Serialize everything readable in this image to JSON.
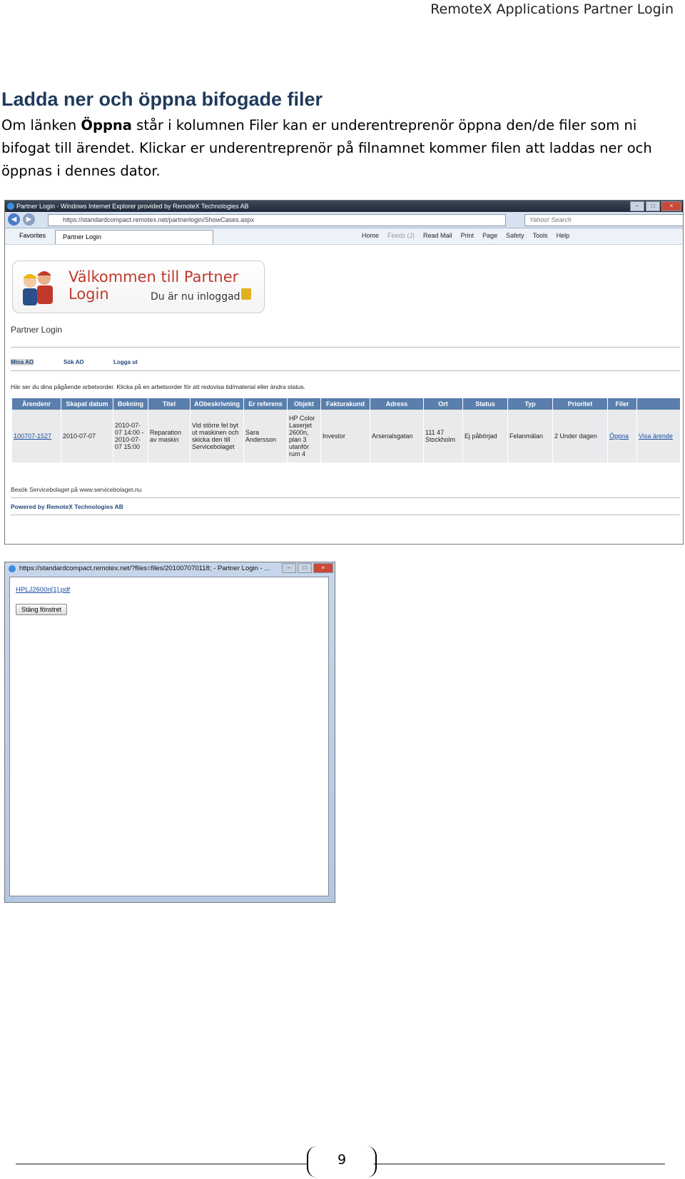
{
  "doc_header": "RemoteX Applications Partner Login",
  "heading": "Ladda ner och öppna bifogade filer",
  "paragraph": {
    "before_bold": "Om länken ",
    "bold": "Öppna",
    "after_bold": " står i kolumnen Filer kan er underentreprenör öppna den/de filer som ni bifogat till ärendet. Klickar er underentreprenör på filnamnet kommer filen att laddas ner och öppnas i dennes dator."
  },
  "browser": {
    "title": "Partner Login - Windows Internet Explorer provided by RemoteX Technologies AB",
    "url": "https://standardcompact.remotex.net/partnerlogin/ShowCases.aspx",
    "search_placeholder": "Yahoo! Search",
    "favorites": "Favorites",
    "tab": "Partner Login",
    "toolbar": [
      "Home",
      "Feeds (J)",
      "Read Mail",
      "Print",
      "Page",
      "Safety",
      "Tools",
      "Help"
    ],
    "welcome": "Välkommen till Partner Login",
    "logged_in": "Du är nu inloggad",
    "section_title": "Partner Login",
    "menu": [
      "Mina AO",
      "Sök AO",
      "Logga ut"
    ],
    "info": "Här ser du dina pågående arbetsorder. Klicka på en arbetsorder för att redovisa tid/material eller ändra status.",
    "columns": [
      "Ärendenr",
      "Skapat datum",
      "Bokning",
      "Titel",
      "AObeskrivning",
      "Er referens",
      "Objekt",
      "Fakturakund",
      "Adress",
      "Ort",
      "Status",
      "Typ",
      "Prioritet",
      "Filer",
      ""
    ],
    "row": {
      "case_no": "100707-1527",
      "created": "2010-07-07",
      "booking": "2010-07-07 14:00 - 2010-07-07 15:00",
      "title": "Reparation av maskin",
      "description": "Vid större fel byt ut maskinen och skicka den till Servicebolaget",
      "reference": "Sara Andersson",
      "object": "HP Color Laserjet 2600n, plan 3 utanför rum 4",
      "invoice_customer": "Investor",
      "address": "Arsenalsgatan",
      "city": "111 47 Stockholm",
      "status": "Ej påbörjad",
      "type": "Felanmälan",
      "priority": "2 Under dagen",
      "files_link": "Öppna",
      "view_link": "Visa ärende"
    },
    "footer_visit": "Besök Servicebolaget på www.servicebolaget.nu",
    "footer_powered": "Powered by RemoteX Technologies AB"
  },
  "popup": {
    "title": "https://standardcompact.remotex.net/?files=files/201007070118; - Partner Login - ...",
    "file_link": "HPLJ2600n[1].pdf",
    "close_button": "Stäng fönstret"
  },
  "page_number": "9"
}
